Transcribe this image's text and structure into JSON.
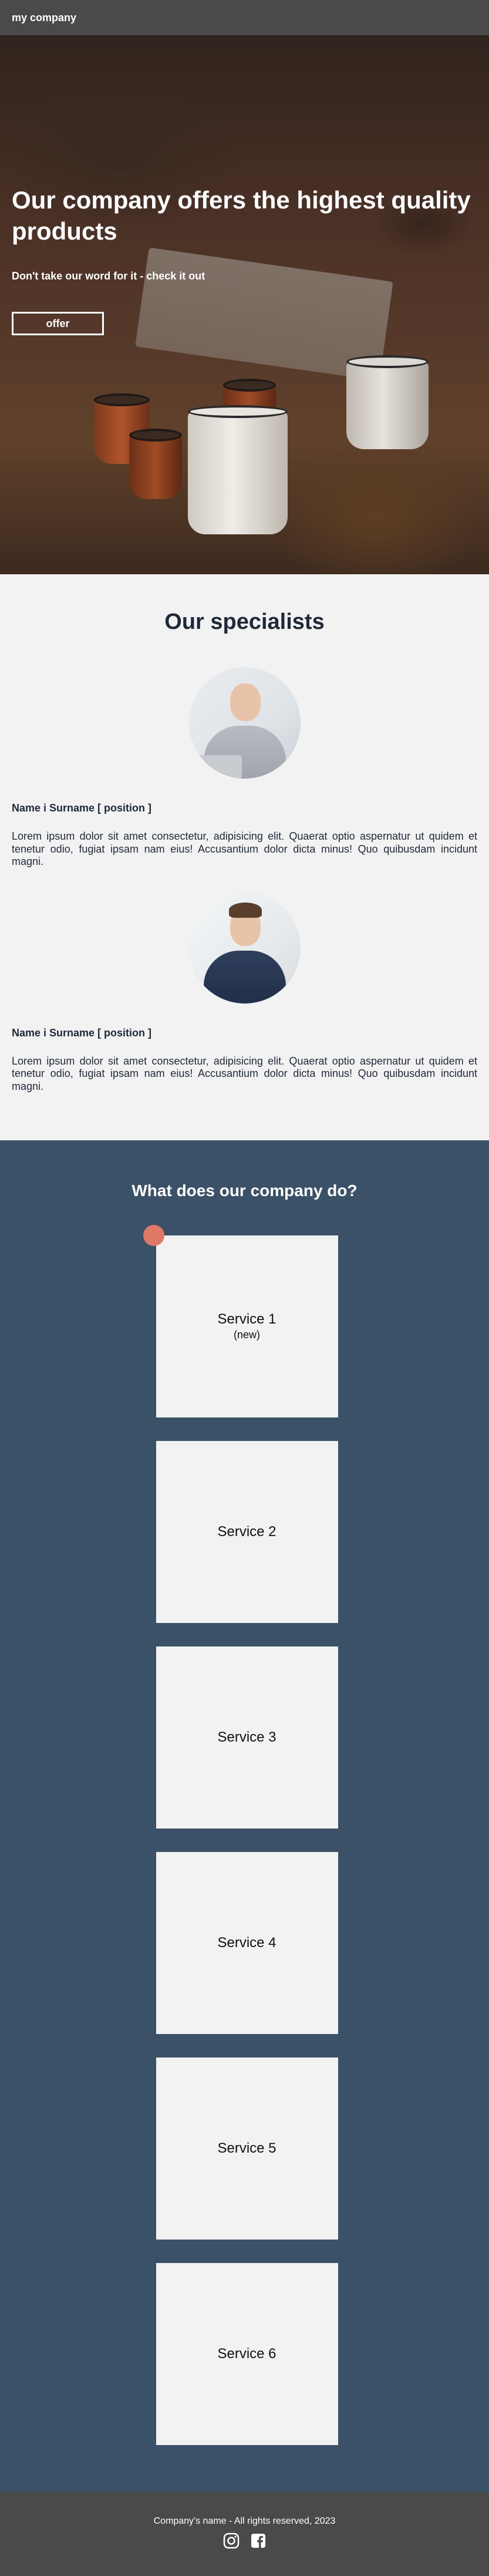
{
  "header": {
    "brand": "my company"
  },
  "hero": {
    "title": "Our company offers the highest quality products",
    "subtitle": "Don't take our word for it - check it out",
    "button_label": "offer"
  },
  "specialists": {
    "title": "Our specialists",
    "people": [
      {
        "name": "Name i Surname [ position ]",
        "description": "Lorem ipsum dolor sit amet consectetur, adipisicing elit. Quaerat optio aspernatur ut quidem et tenetur odio, fugiat ipsam nam eius! Accusantium dolor dicta minus! Quo quibusdam incidunt magni."
      },
      {
        "name": "Name i Surname [ position ]",
        "description": "Lorem ipsum dolor sit amet consectetur, adipisicing elit. Quaerat optio aspernatur ut quidem et tenetur odio, fugiat ipsam nam eius! Accusantium dolor dicta minus! Quo quibusdam incidunt magni."
      }
    ]
  },
  "services": {
    "title": "What does our company do?",
    "items": [
      {
        "name": "Service 1",
        "note": "(new)"
      },
      {
        "name": "Service 2"
      },
      {
        "name": "Service 3"
      },
      {
        "name": "Service 4"
      },
      {
        "name": "Service 5"
      },
      {
        "name": "Service 6"
      }
    ]
  },
  "footer": {
    "text": "Company's name - All rights reserved, 2023",
    "icons": [
      "instagram-icon",
      "facebook-icon"
    ]
  },
  "colors": {
    "header_bg": "#4a4a4a",
    "services_bg": "#3b5168",
    "badge": "#e07a67",
    "text_dark": "#1e2a38"
  }
}
